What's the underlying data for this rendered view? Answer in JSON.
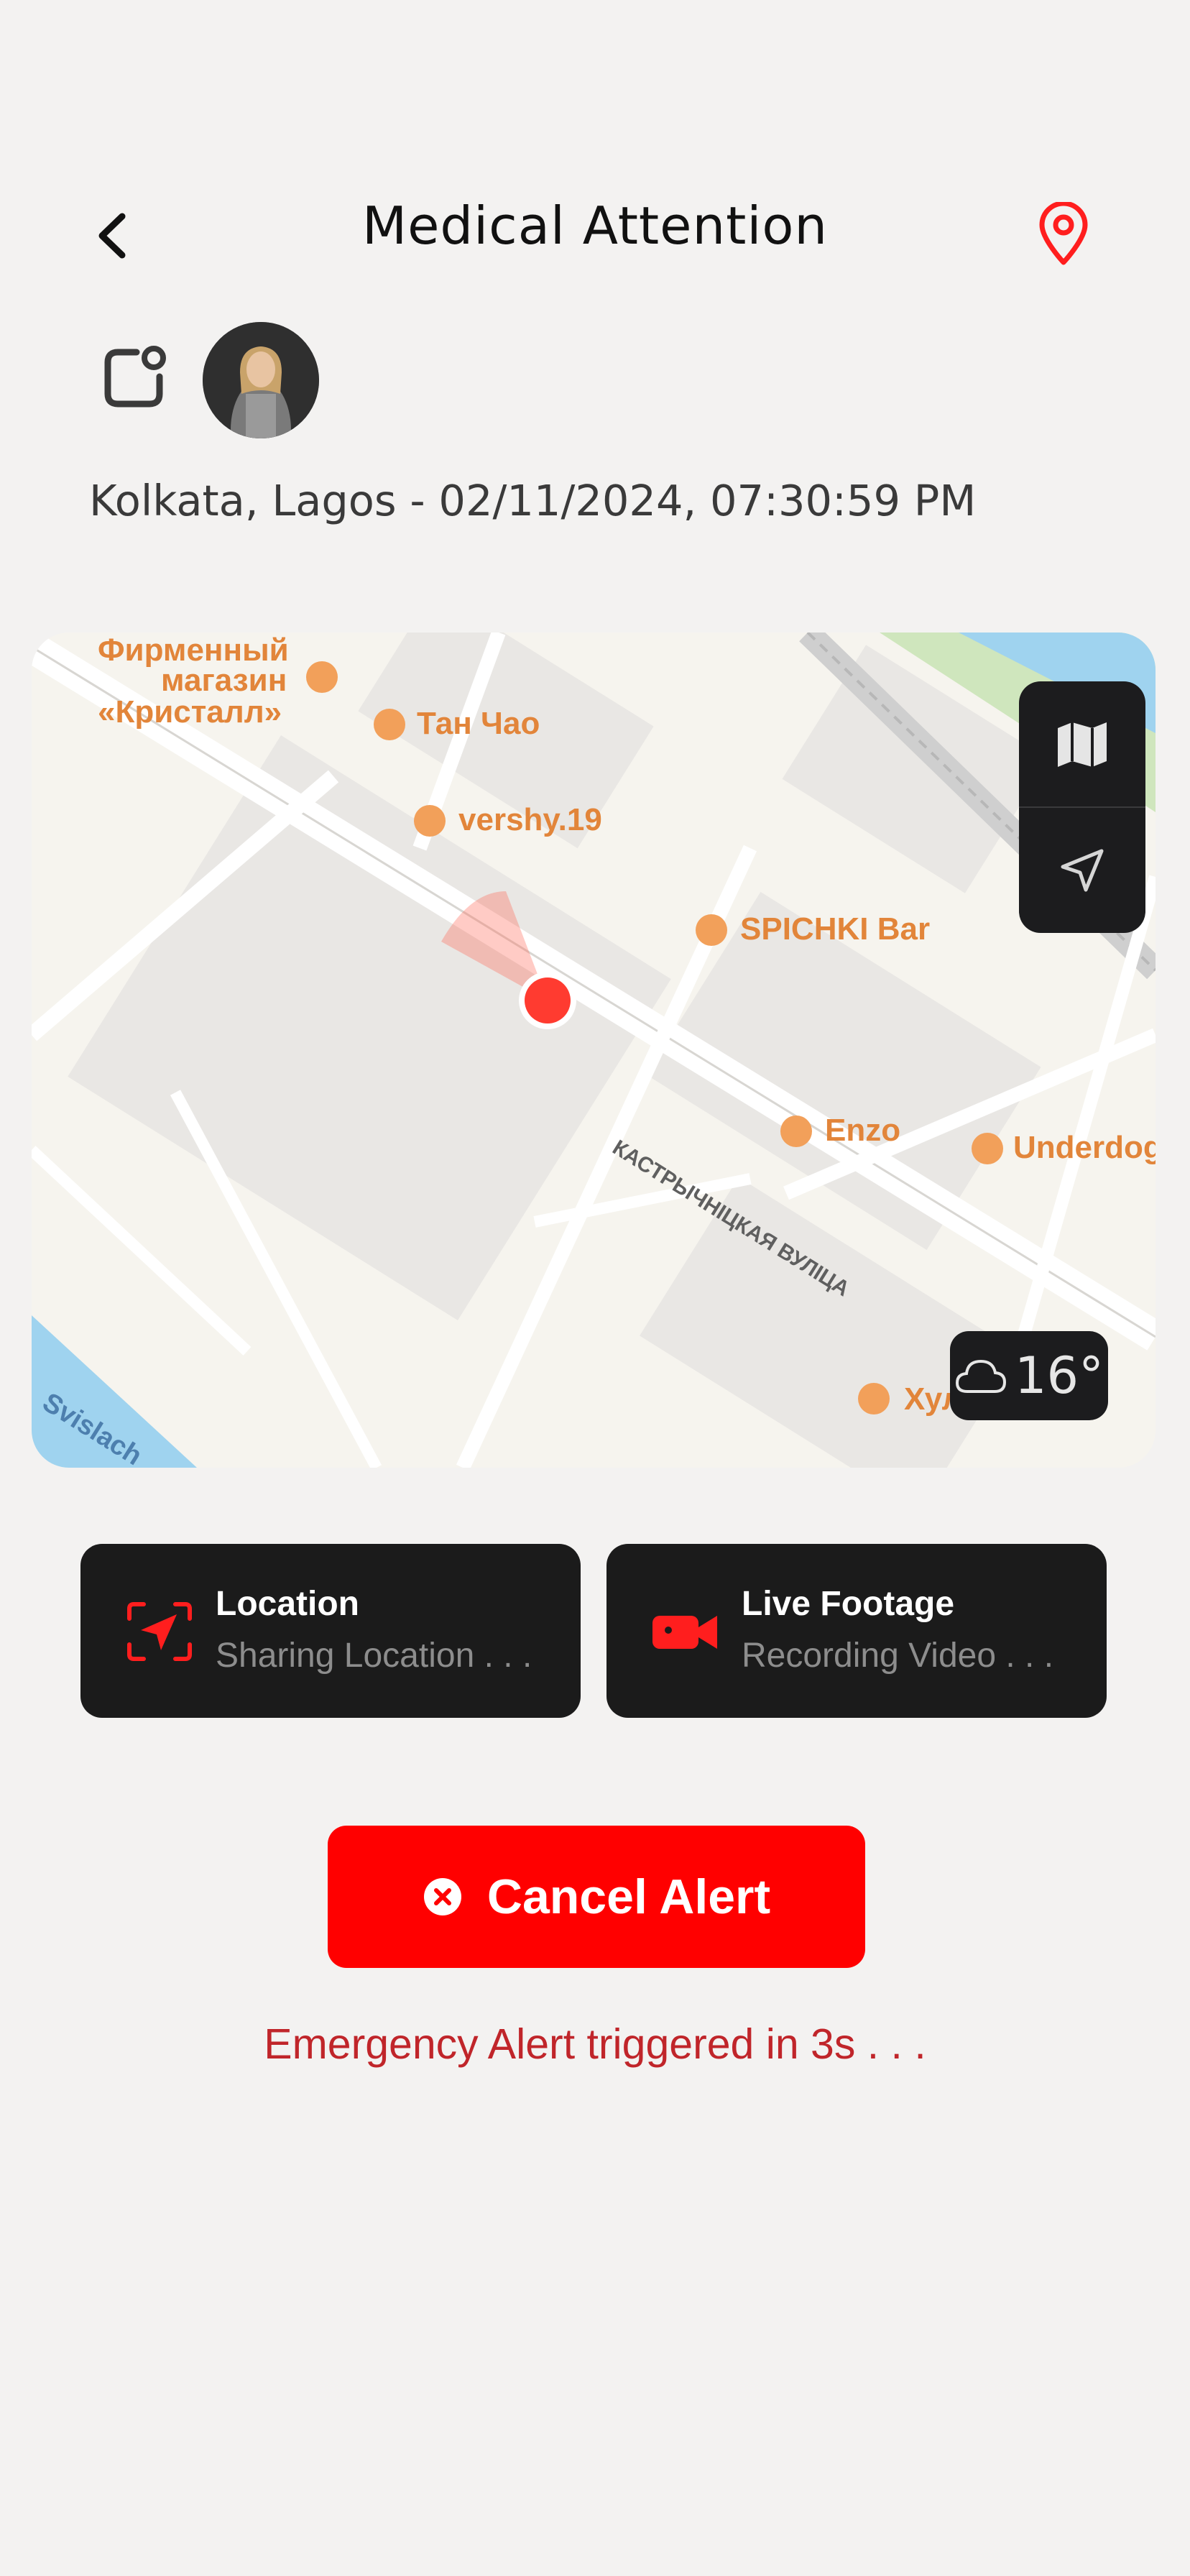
{
  "header": {
    "title": "Medical Attention",
    "back_icon": "chevron-left-icon",
    "pin_icon": "map-pin-icon",
    "accent_color": "#ff1e1e"
  },
  "profile": {
    "notification_icon": "notification-square-icon",
    "avatar": "user-avatar"
  },
  "location_line": "Kolkata, Lagos - 02/11/2024, 07:30:59 PM",
  "map": {
    "labels": [
      "Фирменный",
      "магазин",
      "«Кристалл»",
      "Тан Чао",
      "vershy.19",
      "SPICHKI Bar",
      "Enzo",
      "Underdog",
      "КАСТРЫЧНІЦКАЯ ВУЛІЦА",
      "Svislach",
      "Хулиган"
    ],
    "controls": [
      "map-icon",
      "navigation-arrow-icon"
    ],
    "weather": {
      "icon": "cloud-icon",
      "temperature": "16°"
    },
    "marker_color": "#ff3b30"
  },
  "cards": [
    {
      "title": "Location",
      "subtitle": "Sharing Location . . .",
      "icon": "location-scan-icon"
    },
    {
      "title": "Live Footage",
      "subtitle": "Recording Video . . .",
      "icon": "video-camera-icon"
    }
  ],
  "cancel_button": {
    "label": "Cancel Alert",
    "icon": "close-circle-icon",
    "color": "#ff0000"
  },
  "alert_text": "Emergency Alert triggered in 3s . . .",
  "alert_color": "#c0252a"
}
